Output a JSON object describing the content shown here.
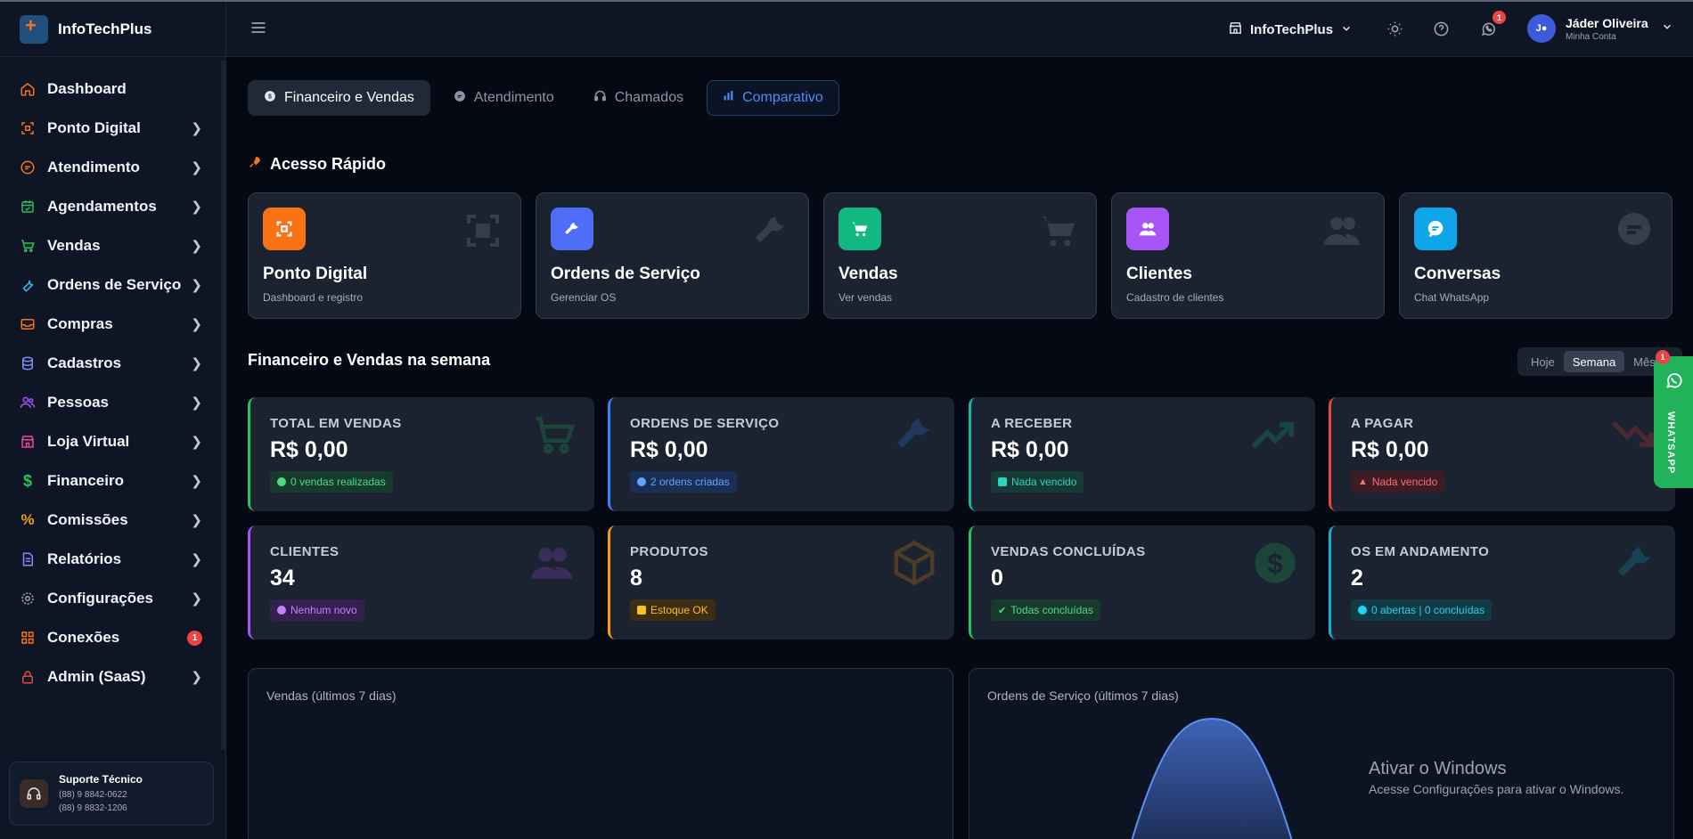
{
  "brand": {
    "name": "InfoTechPlus"
  },
  "sidebar": {
    "items": [
      {
        "label": "Dashboard",
        "color": "#f97316"
      },
      {
        "label": "Ponto Digital",
        "color": "#f97316"
      },
      {
        "label": "Atendimento",
        "color": "#f97316"
      },
      {
        "label": "Agendamentos",
        "color": "#22c55e"
      },
      {
        "label": "Vendas",
        "color": "#22c55e"
      },
      {
        "label": "Ordens de Serviço",
        "color": "#38bdf8"
      },
      {
        "label": "Compras",
        "color": "#f97316"
      },
      {
        "label": "Cadastros",
        "color": "#818cf8"
      },
      {
        "label": "Pessoas",
        "color": "#a855f7"
      },
      {
        "label": "Loja Virtual",
        "color": "#ec4899"
      },
      {
        "label": "Financeiro",
        "color": "#22c55e"
      },
      {
        "label": "Comissões",
        "color": "#f59e0b"
      },
      {
        "label": "Relatórios",
        "color": "#818cf8"
      },
      {
        "label": "Configurações",
        "color": "#9ca3af"
      },
      {
        "label": "Conexões",
        "color": "#f97316",
        "badge": "1"
      },
      {
        "label": "Admin (SaaS)",
        "color": "#ef4444"
      }
    ],
    "support": {
      "title": "Suporte Técnico",
      "phone1": "(88) 9 8842-0622",
      "phone2": "(88) 9 8832-1206"
    }
  },
  "topbar": {
    "org": "InfoTechPlus",
    "notifications": "1",
    "user": {
      "initials": "J●",
      "name": "Jáder Oliveira",
      "subtitle": "Minha Conta"
    }
  },
  "tabs": [
    {
      "label": "Financeiro e Vendas",
      "state": "active"
    },
    {
      "label": "Atendimento",
      "state": "normal"
    },
    {
      "label": "Chamados",
      "state": "normal"
    },
    {
      "label": "Comparativo",
      "state": "outlined"
    }
  ],
  "quick_access": {
    "title": "Acesso Rápido",
    "cards": [
      {
        "name": "Ponto Digital",
        "desc": "Dashboard e registro",
        "color": "#f97316",
        "icon": "scan-icon"
      },
      {
        "name": "Ordens de Serviço",
        "desc": "Gerenciar OS",
        "color": "#4f6ef7",
        "icon": "wrench-icon"
      },
      {
        "name": "Vendas",
        "desc": "Ver vendas",
        "color": "#10b981",
        "icon": "cart-icon"
      },
      {
        "name": "Clientes",
        "desc": "Cadastro de clientes",
        "color": "#a855f7",
        "icon": "users-icon"
      },
      {
        "name": "Conversas",
        "desc": "Chat WhatsApp",
        "color": "#0ea5e9",
        "icon": "chat-icon"
      }
    ]
  },
  "week": {
    "title": "Financeiro e Vendas na semana",
    "periods": [
      {
        "label": "Hoje",
        "on": false
      },
      {
        "label": "Semana",
        "on": true
      },
      {
        "label": "Mês",
        "on": false
      }
    ]
  },
  "stats": [
    {
      "label": "TOTAL EM VENDAS",
      "value": "R$ 0,00",
      "badge": "0 vendas realizadas",
      "color": "#22c55e"
    },
    {
      "label": "ORDENS DE SERVIÇO",
      "value": "R$ 0,00",
      "badge": "2 ordens criadas",
      "color": "#3b82f6"
    },
    {
      "label": "A RECEBER",
      "value": "R$ 0,00",
      "badge": "Nada vencido",
      "color": "#14b8a6"
    },
    {
      "label": "A PAGAR",
      "value": "R$ 0,00",
      "badge": "Nada vencido",
      "color": "#ef4444"
    },
    {
      "label": "CLIENTES",
      "value": "34",
      "badge": "Nenhum novo",
      "color": "#a855f7"
    },
    {
      "label": "PRODUTOS",
      "value": "8",
      "badge": "Estoque OK",
      "color": "#f59e0b"
    },
    {
      "label": "VENDAS CONCLUÍDAS",
      "value": "0",
      "badge": "Todas concluídas",
      "color": "#22c55e"
    },
    {
      "label": "OS EM ANDAMENTO",
      "value": "2",
      "badge": "0 abertas | 0 concluídas",
      "color": "#06b6d4"
    }
  ],
  "charts": {
    "sales_title": "Vendas (últimos 7 dias)",
    "os_title": "Ordens de Serviço (últimos 7 dias)"
  },
  "whatsapp": {
    "label": "WHATSAPP",
    "badge": "1"
  },
  "watermark": {
    "title": "Ativar o Windows",
    "subtitle": "Acesse Configurações para ativar o Windows."
  }
}
